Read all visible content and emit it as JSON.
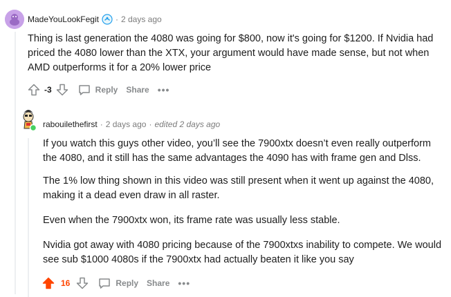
{
  "comment1": {
    "username": "MadeYouLookFegit",
    "time": "2 days ago",
    "body": "Thing is last generation the 4080 was going for $800, now it's going for $1200. If Nvidia had priced the 4080 lower than the XTX, your argument would have made sense, but not when AMD outperforms it for a 20% lower price",
    "score": "-3",
    "reply_label": "Reply",
    "share_label": "Share",
    "more_label": "•••",
    "avatar_color": "#c8a2e8",
    "badge_icon": "achievement-badge-icon"
  },
  "comment2": {
    "username": "rabouilethefirst",
    "time": "2 days ago",
    "edited": "edited 2 days ago",
    "paragraphs": [
      "If you watch this guys other video, you’ll see the 7900xtx doesn’t even really outperform the 4080, and it still has the same advantages the 4090 has with frame gen and Dlss.",
      "The 1% low thing shown in this video was still present when it went up against the 4080, making it a dead even draw in all raster.",
      "Even when the 7900xtx won, its frame rate was usually less stable.",
      "Nvidia got away with 4080 pricing because of the 7900xtxs inability to compete. We would see sub $1000 4080s if the 7900xtx had actually beaten it like you say"
    ],
    "score": "16",
    "reply_label": "Reply",
    "share_label": "Share",
    "more_label": "•••",
    "online_color": "#46d160",
    "upvote_color": "#ff4500"
  },
  "separator": "·"
}
